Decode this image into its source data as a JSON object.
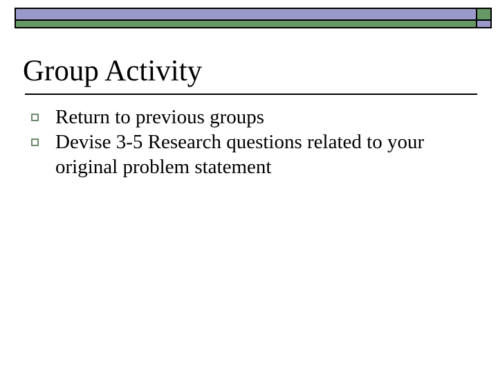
{
  "colors": {
    "bar_purple": "#9999cc",
    "bar_green": "#669966",
    "bullet_border": "#6b8a6b"
  },
  "slide": {
    "title": "Group Activity",
    "bullets": [
      {
        "icon": "hollow-square-bullet",
        "text": "Return to previous groups"
      },
      {
        "icon": "hollow-square-bullet",
        "text": "Devise 3-5 Research questions related to your original problem statement"
      }
    ]
  }
}
